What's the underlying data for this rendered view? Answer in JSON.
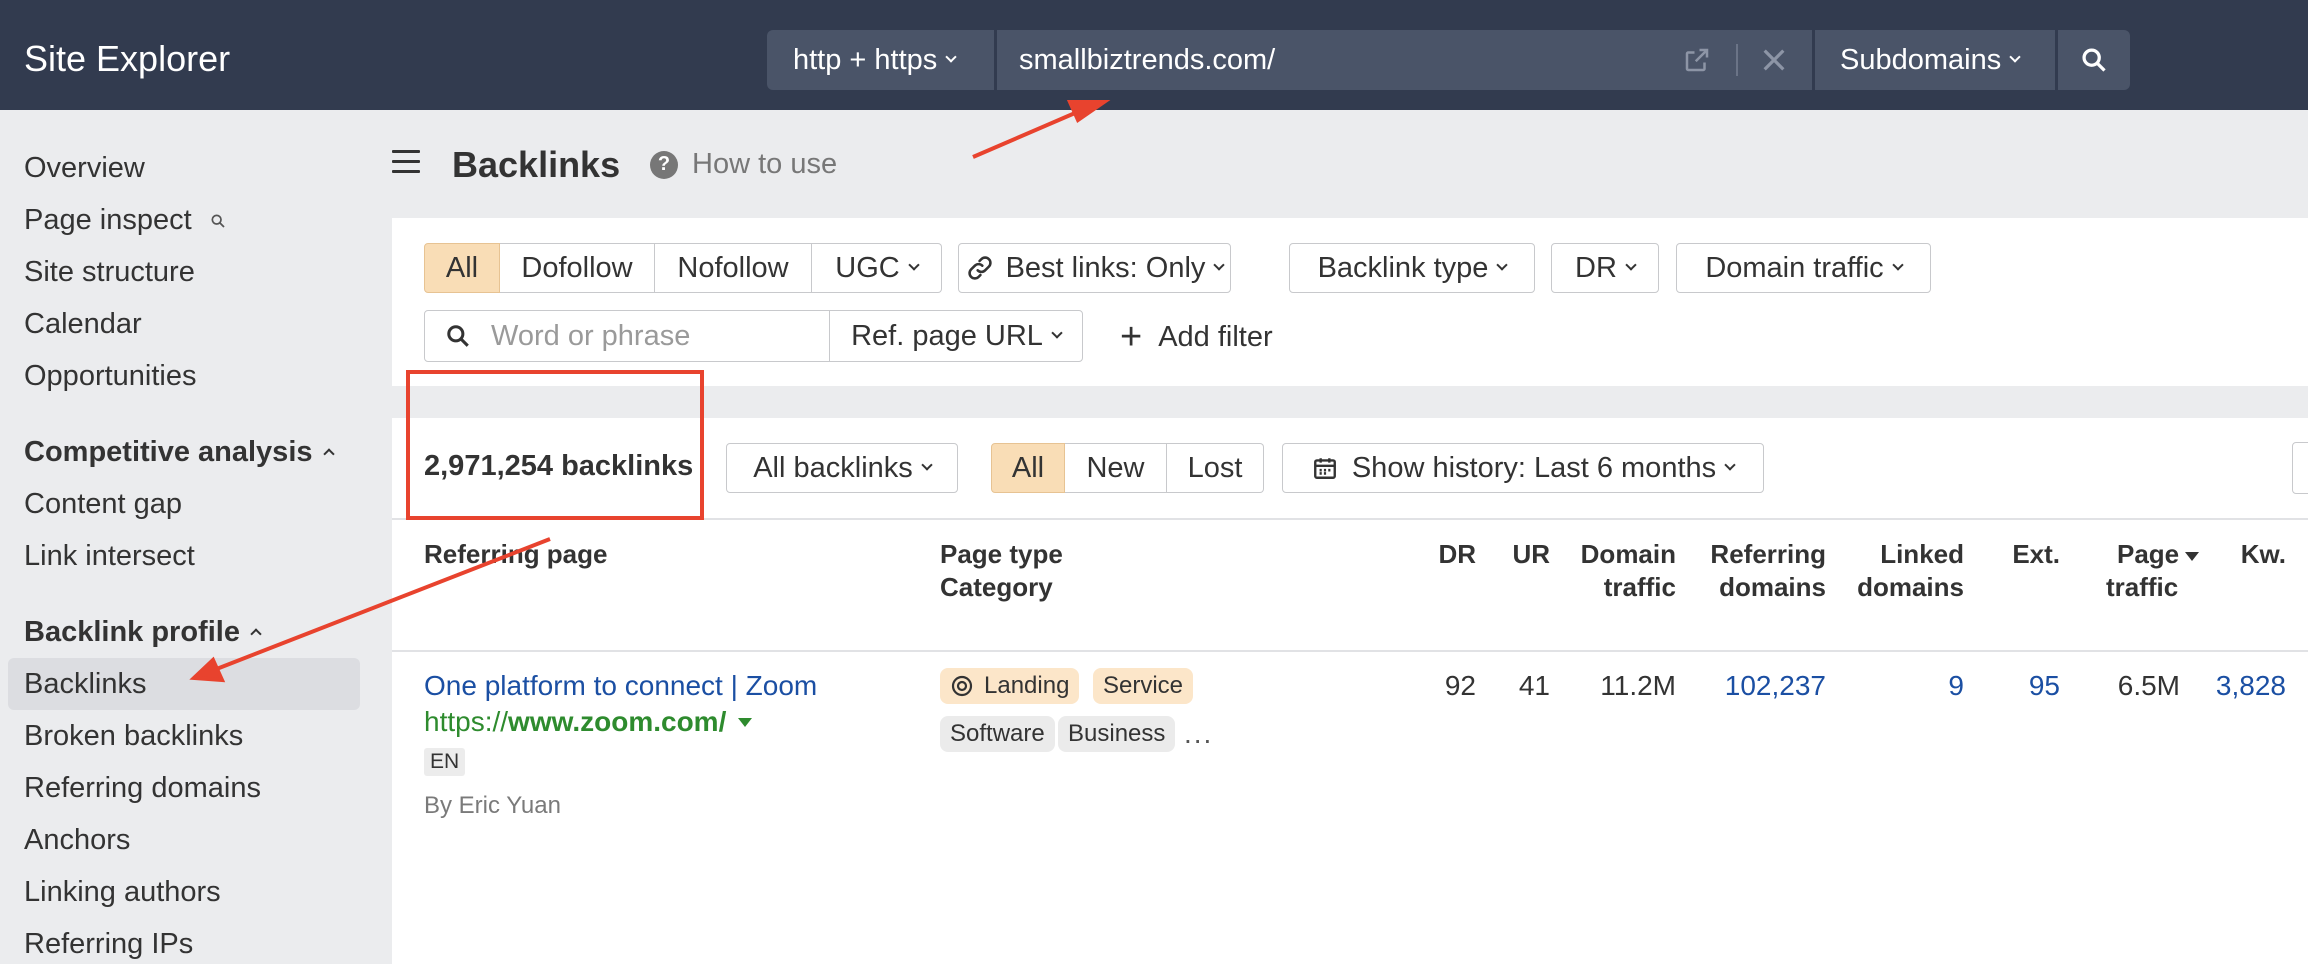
{
  "app": {
    "title": "Site Explorer"
  },
  "searchbar": {
    "protocol": "http + https",
    "url": "smallbiztrends.com/",
    "mode": "Subdomains"
  },
  "sidebar": {
    "top_items": [
      "Overview",
      "Page inspect",
      "Site structure",
      "Calendar",
      "Opportunities"
    ],
    "competitive": {
      "title": "Competitive analysis",
      "items": [
        "Content gap",
        "Link intersect"
      ]
    },
    "backlink_profile": {
      "title": "Backlink profile",
      "items": [
        "Backlinks",
        "Broken backlinks",
        "Referring domains",
        "Anchors",
        "Linking authors",
        "Referring IPs"
      ],
      "active": "Backlinks"
    }
  },
  "header": {
    "title": "Backlinks",
    "how_to_use": "How to use"
  },
  "filters": {
    "link_types": [
      "All",
      "Dofollow",
      "Nofollow",
      "UGC"
    ],
    "selected_link_type": "All",
    "best_links": "Best links: Only",
    "backlink_type": "Backlink type",
    "dr": "DR",
    "domain_traffic": "Domain traffic",
    "search_placeholder": "Word or phrase",
    "ref_page_url": "Ref. page URL",
    "add_filter": "Add filter"
  },
  "results": {
    "count": "2,971,254 backlinks",
    "scope": "All backlinks",
    "tabs": [
      "All",
      "New",
      "Lost"
    ],
    "selected_tab": "All",
    "history": "Show history: Last 6 months"
  },
  "table": {
    "columns": {
      "referring_page": "Referring page",
      "page_type": "Page type",
      "category": "Category",
      "dr": "DR",
      "ur": "UR",
      "domain_traffic": [
        "Domain",
        "traffic"
      ],
      "referring_domains": [
        "Referring",
        "domains"
      ],
      "linked_domains": [
        "Linked",
        "domains"
      ],
      "ext": "Ext.",
      "page_traffic": [
        "Page",
        "traffic"
      ],
      "kw": "Kw."
    },
    "rows": [
      {
        "title": "One platform to connect | Zoom",
        "url_prefix": "https://",
        "url_domain": "www.zoom.com/",
        "lang": "EN",
        "author": "By Eric Yuan",
        "page_types": [
          "Landing",
          "Service"
        ],
        "categories": [
          "Software",
          "Business"
        ],
        "more": "...",
        "dr": "92",
        "ur": "41",
        "domain_traffic": "11.2M",
        "referring_domains": "102,237",
        "linked_domains": "9",
        "ext": "95",
        "page_traffic": "6.5M",
        "kw": "3,828"
      }
    ]
  },
  "colors": {
    "topbar": "#323b4f",
    "accent_selected": "#f9ddb6",
    "link_blue": "#1b4fa3",
    "url_green": "#2e8b2e",
    "annotation_red": "#e8432e"
  }
}
